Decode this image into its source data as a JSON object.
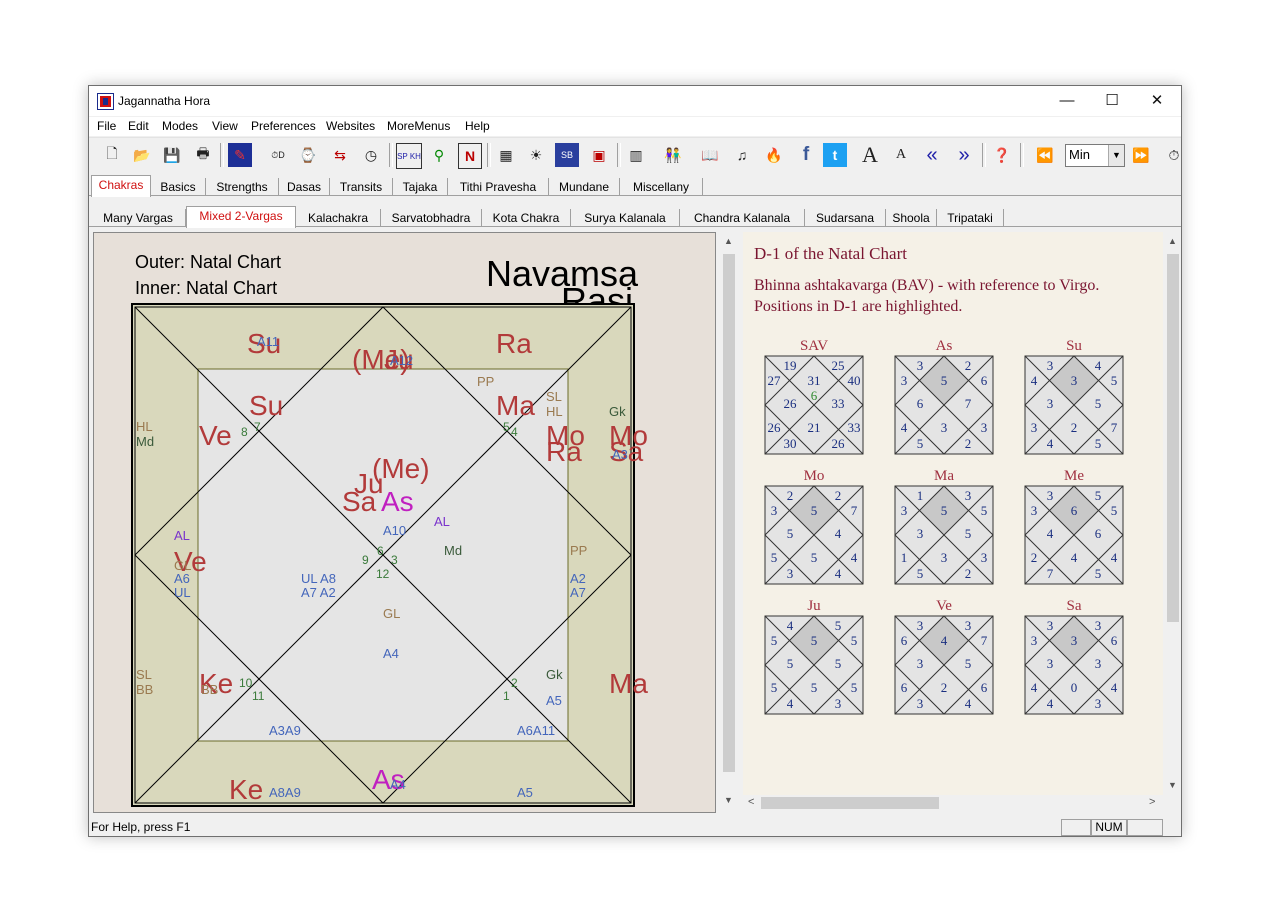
{
  "window": {
    "title": "Jagannatha Hora",
    "min": "—",
    "max": "☐",
    "close": "✕"
  },
  "menu": [
    "File",
    "Edit",
    "Modes",
    "View",
    "Preferences",
    "Websites",
    "MoreMenus",
    "Help"
  ],
  "toolbar": {
    "zoom_value": "Min"
  },
  "tabs_row1": [
    "Chakras",
    "Basics",
    "Strengths",
    "Dasas",
    "Transits",
    "Tajaka",
    "Tithi Pravesha",
    "Mundane",
    "Miscellany"
  ],
  "tabs_row2": [
    "Many Vargas",
    "Mixed 2-Vargas",
    "Kalachakra",
    "Sarvatobhadra",
    "Kota Chakra",
    "Surya Kalanala",
    "Chandra Kalanala",
    "Sudarsana",
    "Shoola",
    "Tripataki"
  ],
  "chart": {
    "outer_label": "Outer: Natal Chart",
    "inner_label": "Inner: Natal Chart",
    "outer_varga": "Navamsa",
    "inner_varga": "Rasi"
  },
  "bav": {
    "heading": "D-1 of the Natal Chart",
    "subheading": "Bhinna ashtakavarga (BAV) - with reference to Virgo.",
    "subheading2": "Positions in D-1 are highlighted.",
    "grids": [
      {
        "label": "SAV",
        "values": [
          "19",
          "25",
          "27",
          "31",
          "40",
          "26",
          "6",
          "33",
          "26",
          "21",
          "33",
          "30",
          "26"
        ]
      },
      {
        "label": "As",
        "values": [
          "3",
          "2",
          "3",
          "5",
          "6",
          "6",
          "7",
          "4",
          "3",
          "3",
          "5",
          "2"
        ]
      },
      {
        "label": "Su",
        "values": [
          "3",
          "4",
          "4",
          "3",
          "5",
          "3",
          "5",
          "3",
          "2",
          "7",
          "4",
          "5"
        ]
      },
      {
        "label": "Mo",
        "values": [
          "2",
          "2",
          "3",
          "5",
          "7",
          "5",
          "4",
          "5",
          "5",
          "4",
          "3",
          "4"
        ]
      },
      {
        "label": "Ma",
        "values": [
          "1",
          "3",
          "3",
          "5",
          "5",
          "3",
          "5",
          "1",
          "3",
          "3",
          "5",
          "2"
        ]
      },
      {
        "label": "Me",
        "values": [
          "3",
          "5",
          "3",
          "6",
          "5",
          "4",
          "6",
          "2",
          "4",
          "4",
          "7",
          "5"
        ]
      },
      {
        "label": "Ju",
        "values": [
          "4",
          "5",
          "5",
          "5",
          "5",
          "5",
          "5",
          "5",
          "5",
          "5",
          "4",
          "3"
        ]
      },
      {
        "label": "Ve",
        "values": [
          "3",
          "3",
          "6",
          "4",
          "7",
          "3",
          "5",
          "6",
          "2",
          "6",
          "3",
          "4"
        ]
      },
      {
        "label": "Sa",
        "values": [
          "3",
          "3",
          "3",
          "3",
          "6",
          "3",
          "3",
          "4",
          "0",
          "4",
          "4",
          "3"
        ]
      }
    ]
  },
  "status": {
    "help": "For Help, press F1",
    "num": "NUM"
  }
}
